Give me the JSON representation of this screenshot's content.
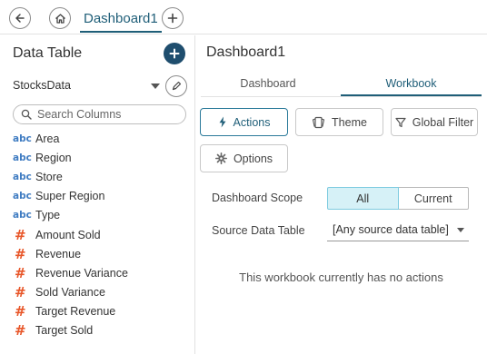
{
  "header": {
    "back_icon": "arrow-left-icon",
    "home_icon": "home-icon",
    "tab_label": "Dashboard1",
    "add_icon": "plus-icon"
  },
  "left_panel": {
    "title": "Data Table",
    "add_icon": "plus-circle-icon",
    "source_name": "StocksData",
    "edit_icon": "pencil-icon",
    "search": {
      "placeholder": "Search Columns",
      "value": ""
    },
    "columns": [
      {
        "type": "abc",
        "name": "Area"
      },
      {
        "type": "abc",
        "name": "Region"
      },
      {
        "type": "abc",
        "name": "Store"
      },
      {
        "type": "abc",
        "name": "Super Region"
      },
      {
        "type": "abc",
        "name": "Type"
      },
      {
        "type": "#",
        "name": "Amount Sold"
      },
      {
        "type": "#",
        "name": "Revenue"
      },
      {
        "type": "#",
        "name": "Revenue Variance"
      },
      {
        "type": "#",
        "name": "Sold Variance"
      },
      {
        "type": "#",
        "name": "Target Revenue"
      },
      {
        "type": "#",
        "name": "Target Sold"
      }
    ]
  },
  "right_panel": {
    "title": "Dashboard1",
    "tabs": [
      {
        "label": "Dashboard",
        "active": false
      },
      {
        "label": "Workbook",
        "active": true
      }
    ],
    "toolbar": {
      "actions_label": "Actions",
      "theme_label": "Theme",
      "global_filter_label": "Global Filter",
      "options_label": "Options"
    },
    "scope": {
      "label": "Dashboard Scope",
      "options": [
        "All",
        "Current"
      ],
      "selected": "All"
    },
    "source_table": {
      "label": "Source Data Table",
      "value": "[Any source data table]"
    },
    "empty_message": "This workbook currently has no actions"
  },
  "colors": {
    "accent": "#1f5e78",
    "add_button": "#1f4e6e",
    "text_type": "#3f7cc2",
    "numeric_type": "#e8572a",
    "scope_selected_bg": "#d6f1f7"
  }
}
